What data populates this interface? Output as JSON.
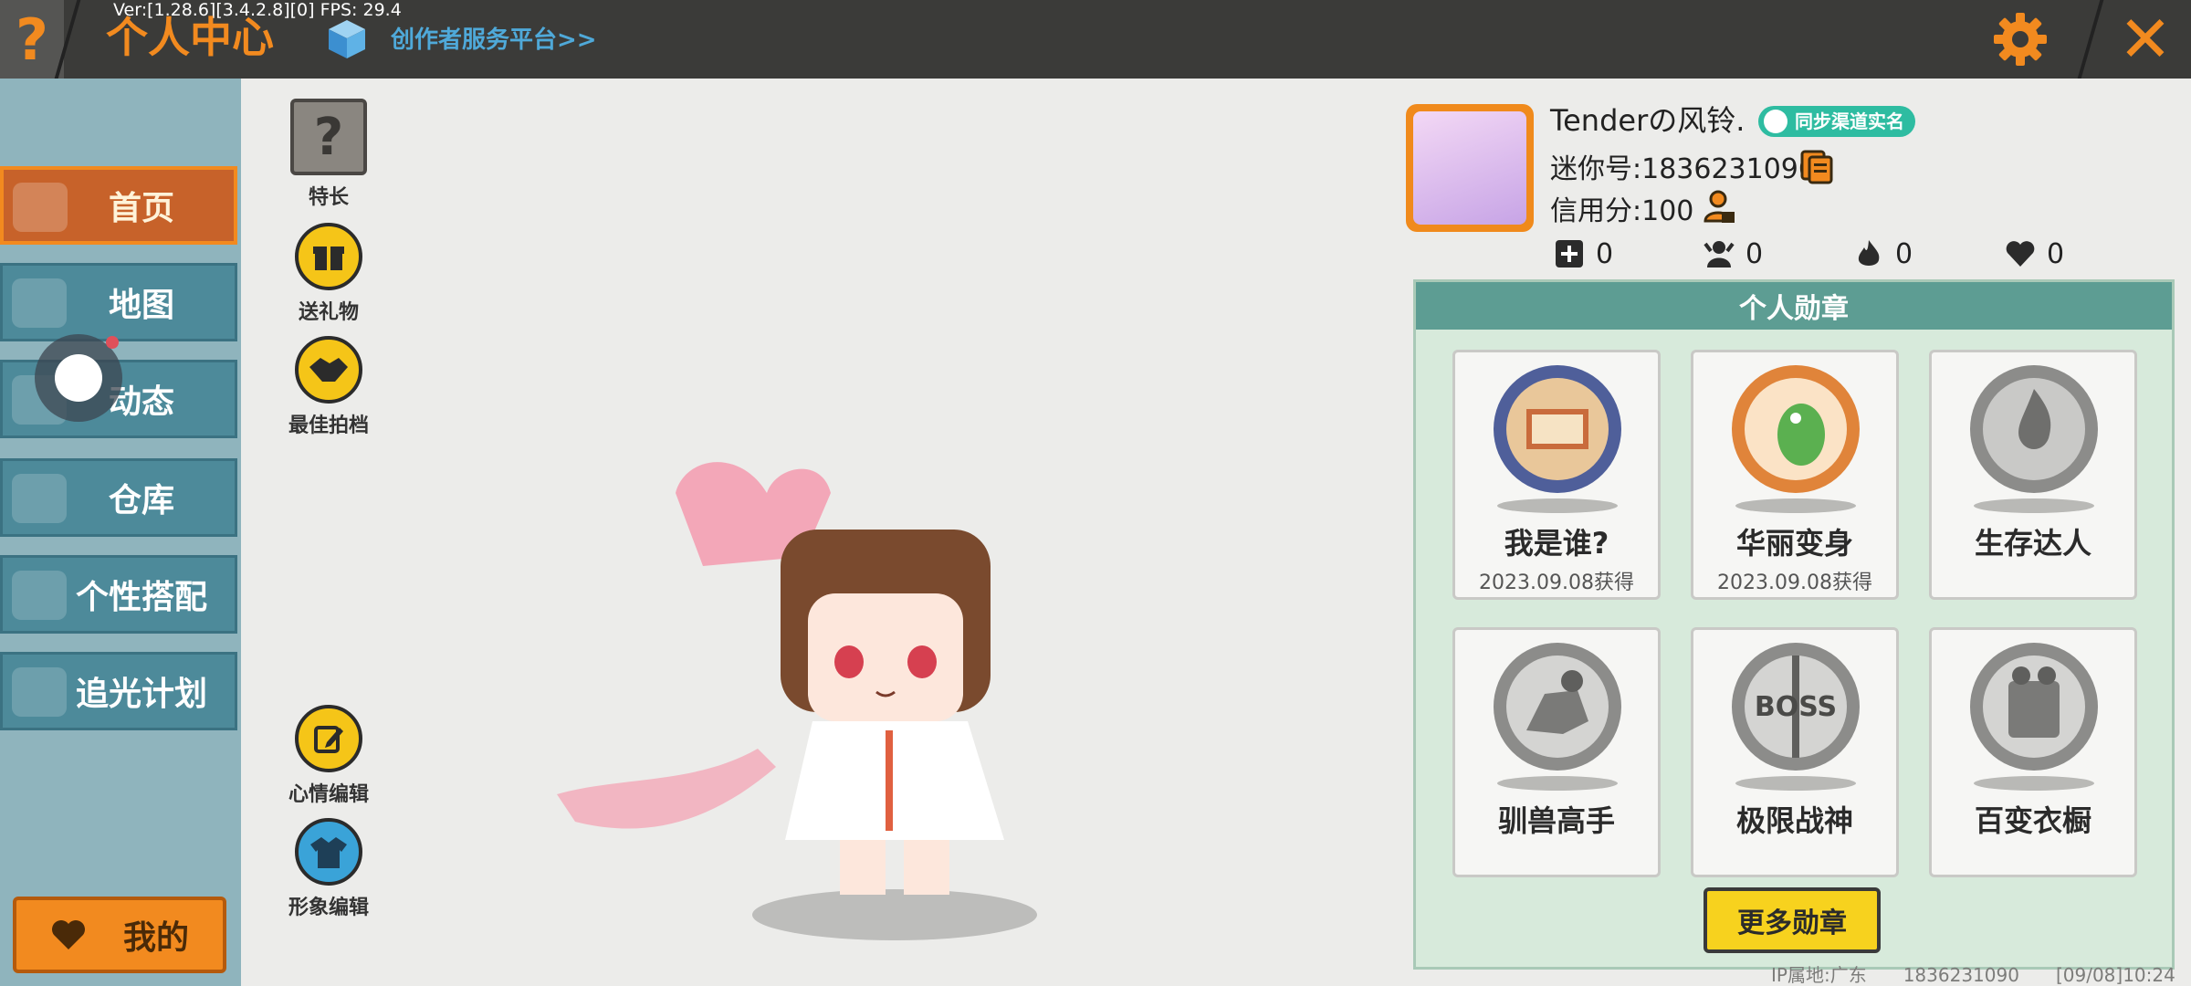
{
  "topbar": {
    "help_symbol": "?",
    "debug": "Ver:[1.28.6][3.4.2.8][0] FPS: 29.4",
    "title": "个人中心",
    "creator_link": "创作者服务平台>>",
    "close_symbol": "✕"
  },
  "sidebar": {
    "items": [
      {
        "label": "首页",
        "active": true
      },
      {
        "label": "地图",
        "active": false
      },
      {
        "label": "动态",
        "active": false
      },
      {
        "label": "仓库",
        "active": false
      },
      {
        "label": "个性搭配",
        "active": false
      },
      {
        "label": "追光计划",
        "active": false
      }
    ],
    "mine_label": "我的"
  },
  "actions": {
    "talent_symbol": "?",
    "talent": "特长",
    "gift": "送礼物",
    "best_partner": "最佳拍档",
    "mood_edit": "心情编辑",
    "avatar_edit": "形象编辑"
  },
  "profile": {
    "name": "Tenderの风铃.",
    "sync_badge": "同步渠道实名",
    "mini_id": "迷你号:1836231090",
    "credit": "信用分:100",
    "stats": [
      "0",
      "0",
      "0",
      "0"
    ]
  },
  "medals": {
    "title": "个人勋章",
    "items": [
      {
        "name": "我是谁?",
        "date": "2023.09.08获得",
        "color": "#7e8fc0"
      },
      {
        "name": "华丽变身",
        "date": "2023.09.08获得",
        "color": "#e89a4f"
      },
      {
        "name": "生存达人",
        "date": "",
        "color": "#9a9a98"
      },
      {
        "name": "驯兽高手",
        "date": "",
        "color": "#9a9a98"
      },
      {
        "name": "极限战神",
        "date": "",
        "color": "#9a9a98"
      },
      {
        "name": "百变衣橱",
        "date": "",
        "color": "#9a9a98"
      }
    ],
    "more_button": "更多勋章"
  },
  "footer": {
    "ip_location": "IP属地:广东",
    "uid": "1836231090",
    "timestamp": "[09/08]10:24"
  },
  "colors": {
    "accent": "#f28a1f",
    "sidebar_active": "#c7622a",
    "sidebar_item": "#4d8a9a",
    "panel_header": "#5d9d93",
    "button_yellow": "#f7d21e"
  }
}
